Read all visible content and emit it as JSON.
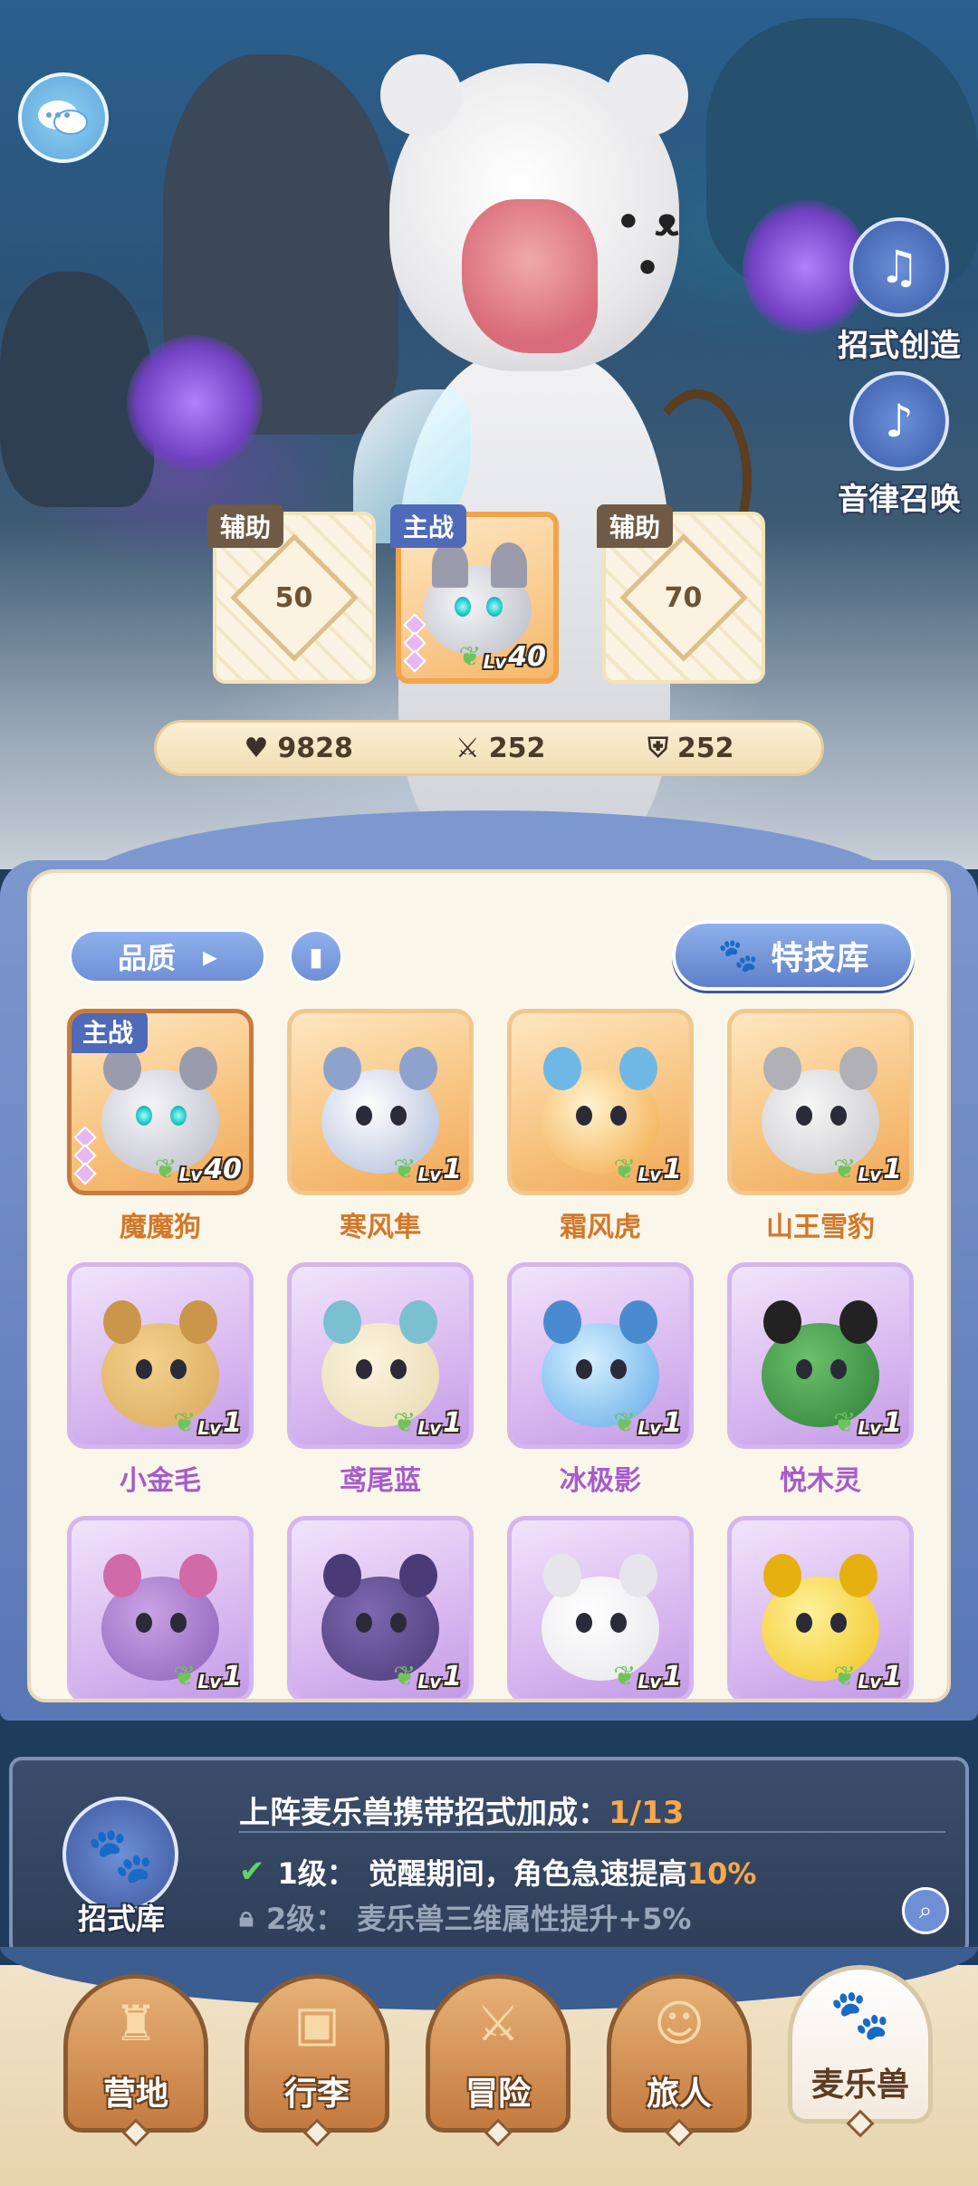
{
  "side_actions": [
    {
      "label": "招式创造",
      "icon": "music-book-icon"
    },
    {
      "label": "音律召唤",
      "icon": "lyre-icon"
    }
  ],
  "lineup": {
    "left": {
      "tag": "辅助",
      "value": "50"
    },
    "main": {
      "tag": "主战",
      "level": "40",
      "lv_prefix": "Lv"
    },
    "right": {
      "tag": "辅助",
      "value": "70"
    }
  },
  "stats": {
    "hp": "9828",
    "attack": "252",
    "defense": "252"
  },
  "panel": {
    "quality_label": "品质",
    "skill_library_label": "特技库"
  },
  "pets": [
    {
      "name": "魔魔狗",
      "level": "40",
      "rarity": "orange",
      "tag": "主战"
    },
    {
      "name": "寒风隼",
      "level": "1",
      "rarity": "orange"
    },
    {
      "name": "霜风虎",
      "level": "1",
      "rarity": "orange"
    },
    {
      "name": "山王雪豹",
      "level": "1",
      "rarity": "orange"
    },
    {
      "name": "小金毛",
      "level": "1",
      "rarity": "purple"
    },
    {
      "name": "鸢尾蓝",
      "level": "1",
      "rarity": "purple"
    },
    {
      "name": "冰极影",
      "level": "1",
      "rarity": "purple"
    },
    {
      "name": "悦木灵",
      "level": "1",
      "rarity": "purple"
    },
    {
      "name": "",
      "level": "1",
      "rarity": "purple"
    },
    {
      "name": "",
      "level": "1",
      "rarity": "purple"
    },
    {
      "name": "",
      "level": "1",
      "rarity": "purple"
    },
    {
      "name": "",
      "level": "1",
      "rarity": "purple"
    }
  ],
  "bonus": {
    "icon_label": "招式库",
    "title": "上阵麦乐兽携带招式加成：",
    "count": "1/13",
    "level1_prefix": "1级：",
    "level1_text": "觉醒期间，角色急速提高",
    "level1_value": "10%",
    "level2_prefix": "2级：",
    "level2_text": "麦乐兽三维属性提升+5%"
  },
  "nav": [
    {
      "label": "营地",
      "icon": "castle-icon"
    },
    {
      "label": "行李",
      "icon": "backpack-icon"
    },
    {
      "label": "冒险",
      "icon": "swords-icon"
    },
    {
      "label": "旅人",
      "icon": "traveler-icon"
    },
    {
      "label": "麦乐兽",
      "icon": "pet-icon",
      "active": true
    }
  ],
  "colors": {
    "accent_blue": "#6e8fd6",
    "orange_rarity": "#f7c27d",
    "purple_rarity": "#d9b8f0",
    "highlight": "#f5a94b"
  }
}
